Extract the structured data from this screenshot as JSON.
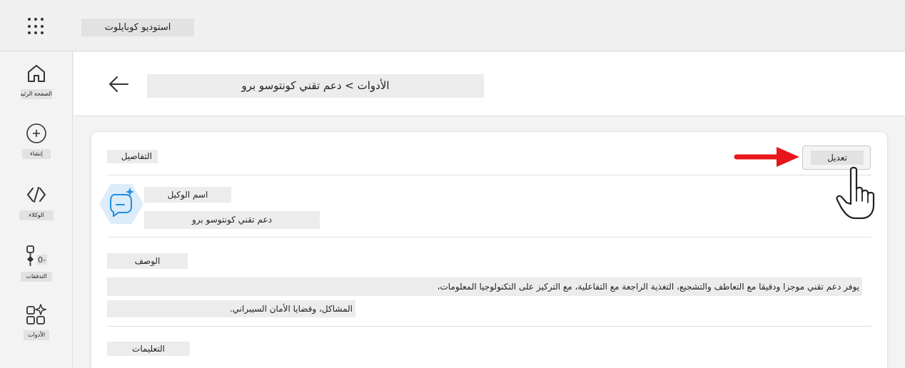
{
  "app": {
    "title": "استوديو كوبايلوت"
  },
  "nav": {
    "items": [
      {
        "label": "الصفحة الرئيسية",
        "icon": "home-icon"
      },
      {
        "label": "إنشاء",
        "icon": "create-icon"
      },
      {
        "label": "الوكلاء",
        "icon": "agents-icon"
      },
      {
        "label": "التدفقات",
        "icon": "flows-icon"
      },
      {
        "label": "الأدوات",
        "icon": "tools-icon"
      }
    ]
  },
  "header": {
    "back_icon": "arrow-left-icon",
    "breadcrumb": "الأدوات > دعم تقني كونتوسو برو"
  },
  "details": {
    "section_title": "التفاصيل",
    "edit_label": "تعديل",
    "name_label": "اسم الوكيل",
    "name_value": "دعم تقني كونتوسو برو",
    "agent_icon": "chat-sparkle-icon",
    "description_title": "الوصف",
    "description_line1": "يوفر دعم تقني موجزا ودقيقا مع التعاطف والتشجيع، التغذية الراجعة مع التفاعلية، مع التركيز على التكنولوجيا المعلومات،",
    "description_line2": "المشاكل، وقضايا الأمان السيبراني.",
    "instructions_title": "التعليمات"
  },
  "colors": {
    "accent_arrow": "#e8161b",
    "hex_icon_bg": "#dcecfa",
    "icon_blue": "#1f8fe0"
  },
  "annotations": {
    "pointer_arrow": "red-arrow-icon",
    "hand_cursor": "hand-pointer-icon"
  }
}
